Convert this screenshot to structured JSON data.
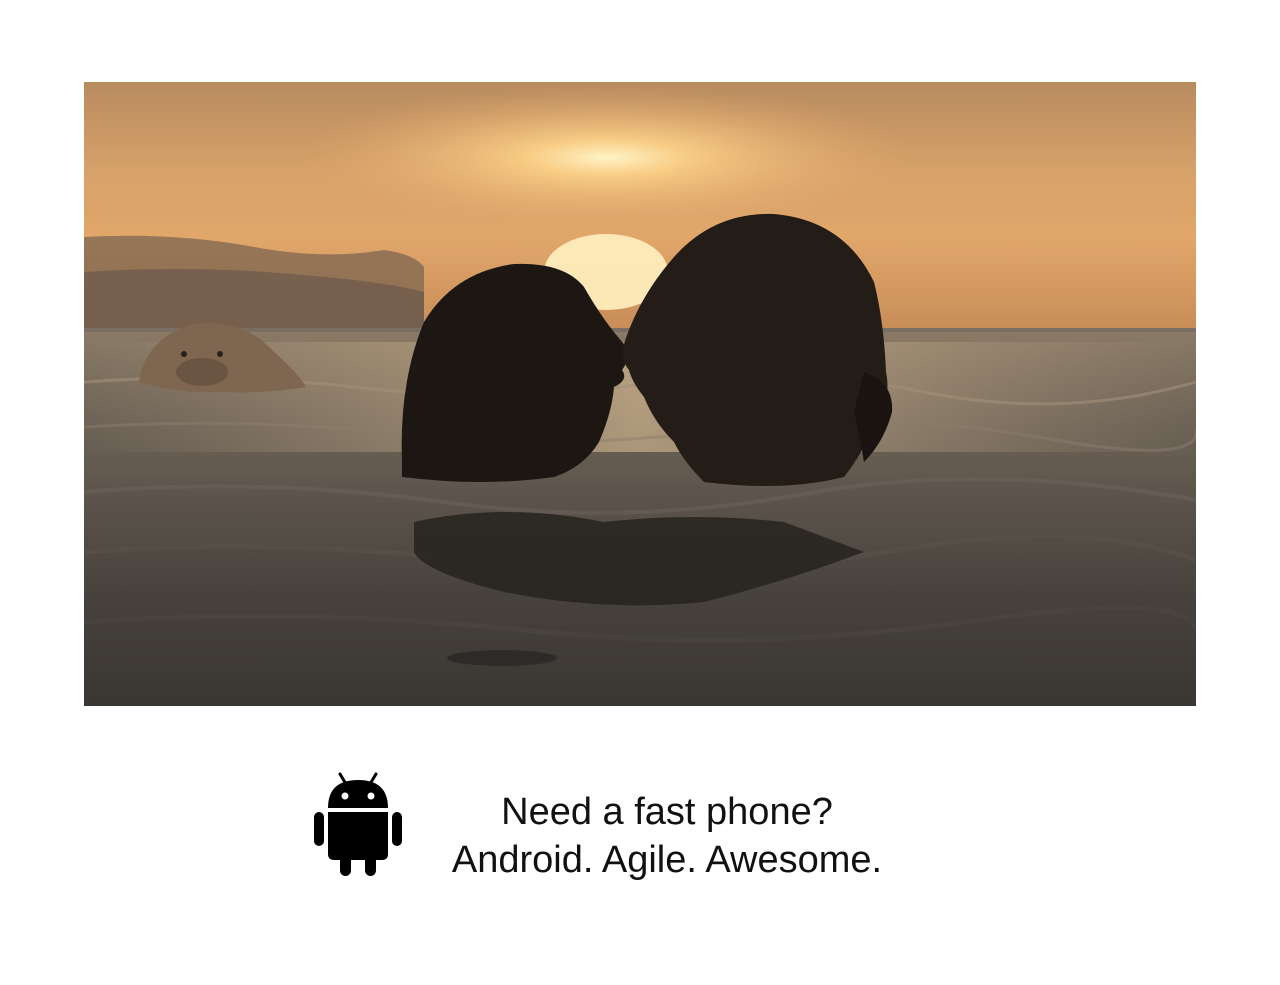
{
  "hero_image": {
    "icon": "sunset-ocean-couple-kissing-walrus-photo"
  },
  "ad": {
    "logo_icon": "android-robot-icon",
    "line1": "Need a fast phone?",
    "line2": "Android. Agile. Awesome."
  },
  "colors": {
    "background": "#ffffff",
    "text": "#111111",
    "logo": "#000000",
    "sky_top": "#b98a5c",
    "sun": "#fff3c4",
    "water": "#4b4641"
  }
}
